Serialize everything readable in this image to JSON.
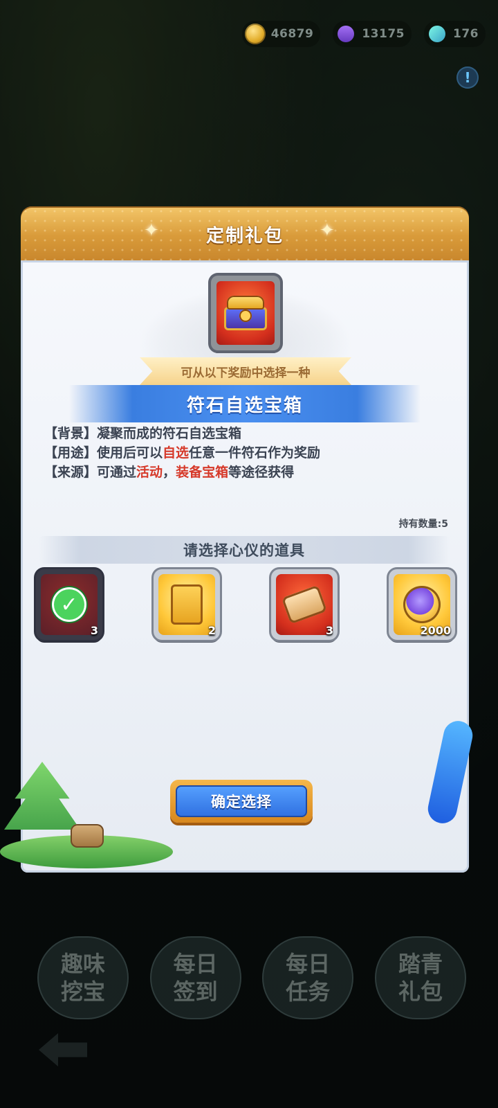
{
  "resources": {
    "coins": "46879",
    "gems": "13175",
    "crystals": "176",
    "coin_icon": "coin-icon",
    "gem_icon": "purple-gem-icon",
    "crystal_icon": "crystal-icon"
  },
  "alert_icon": "!",
  "dialog": {
    "title": "定制礼包",
    "subtitle_ribbon": "可从以下奖励中选择一种",
    "item_name": "符石自选宝箱",
    "description": {
      "background_label": "【背景】",
      "background_text": "凝聚而成的符石自选宝箱",
      "usage_label": "【用途】",
      "usage_prefix": "使用后可以",
      "usage_highlight": "自选",
      "usage_suffix": "任意一件符石作为奖励",
      "source_label": "【来源】",
      "source_prefix": "可通过",
      "source_highlight1": "活动",
      "source_sep": "，",
      "source_highlight2": "装备宝箱",
      "source_suffix": "等途径获得"
    },
    "owned_label": "持有数量:5",
    "select_prompt": "请选择心仪的道具",
    "rewards": [
      {
        "icon": "treasure-chest-icon",
        "count": "3",
        "selected": true
      },
      {
        "icon": "gold-card-icon",
        "count": "2",
        "selected": false
      },
      {
        "icon": "scroll-icon",
        "count": "3",
        "selected": false
      },
      {
        "icon": "purple-medal-icon",
        "count": "2000",
        "selected": false
      }
    ],
    "confirm_button": "确定选择"
  },
  "bottom_menu": [
    {
      "label": "趣味\n挖宝"
    },
    {
      "label": "每日\n签到"
    },
    {
      "label": "每日\n任务"
    },
    {
      "label": "踏青\n礼包"
    }
  ],
  "colors": {
    "highlight_red": "#d6392a",
    "header_gold": "#d99b3a",
    "confirm_blue": "#2f6fe0"
  }
}
